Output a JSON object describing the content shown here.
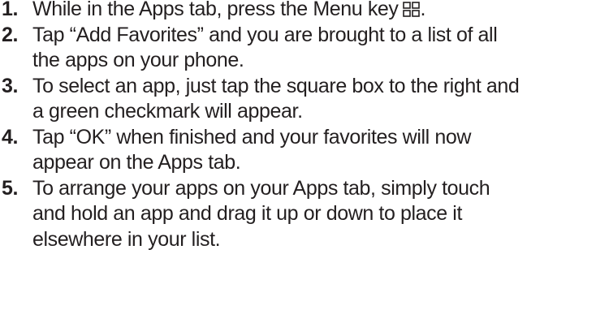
{
  "steps": [
    {
      "number": "1.",
      "lines": [
        "While in the Apps tab, press the Menu key"
      ],
      "trailing_text": ".",
      "icon": "menu-grid-icon"
    },
    {
      "number": "2.",
      "lines": [
        "Tap “Add Favorites” and you are brought to a list of all",
        "the apps on your phone."
      ]
    },
    {
      "number": "3.",
      "lines": [
        "To select an app, just tap the square box to the right and",
        "a green checkmark will appear."
      ]
    },
    {
      "number": "4.",
      "lines": [
        "Tap “OK” when finished and your favorites will now",
        "appear on the Apps tab."
      ]
    },
    {
      "number": "5.",
      "lines": [
        "To arrange your apps on your Apps tab, simply touch",
        "and hold an app and drag it up or down to place it",
        "elsewhere in your list."
      ]
    }
  ],
  "colors": {
    "text": "#231f20",
    "background": "#ffffff"
  }
}
